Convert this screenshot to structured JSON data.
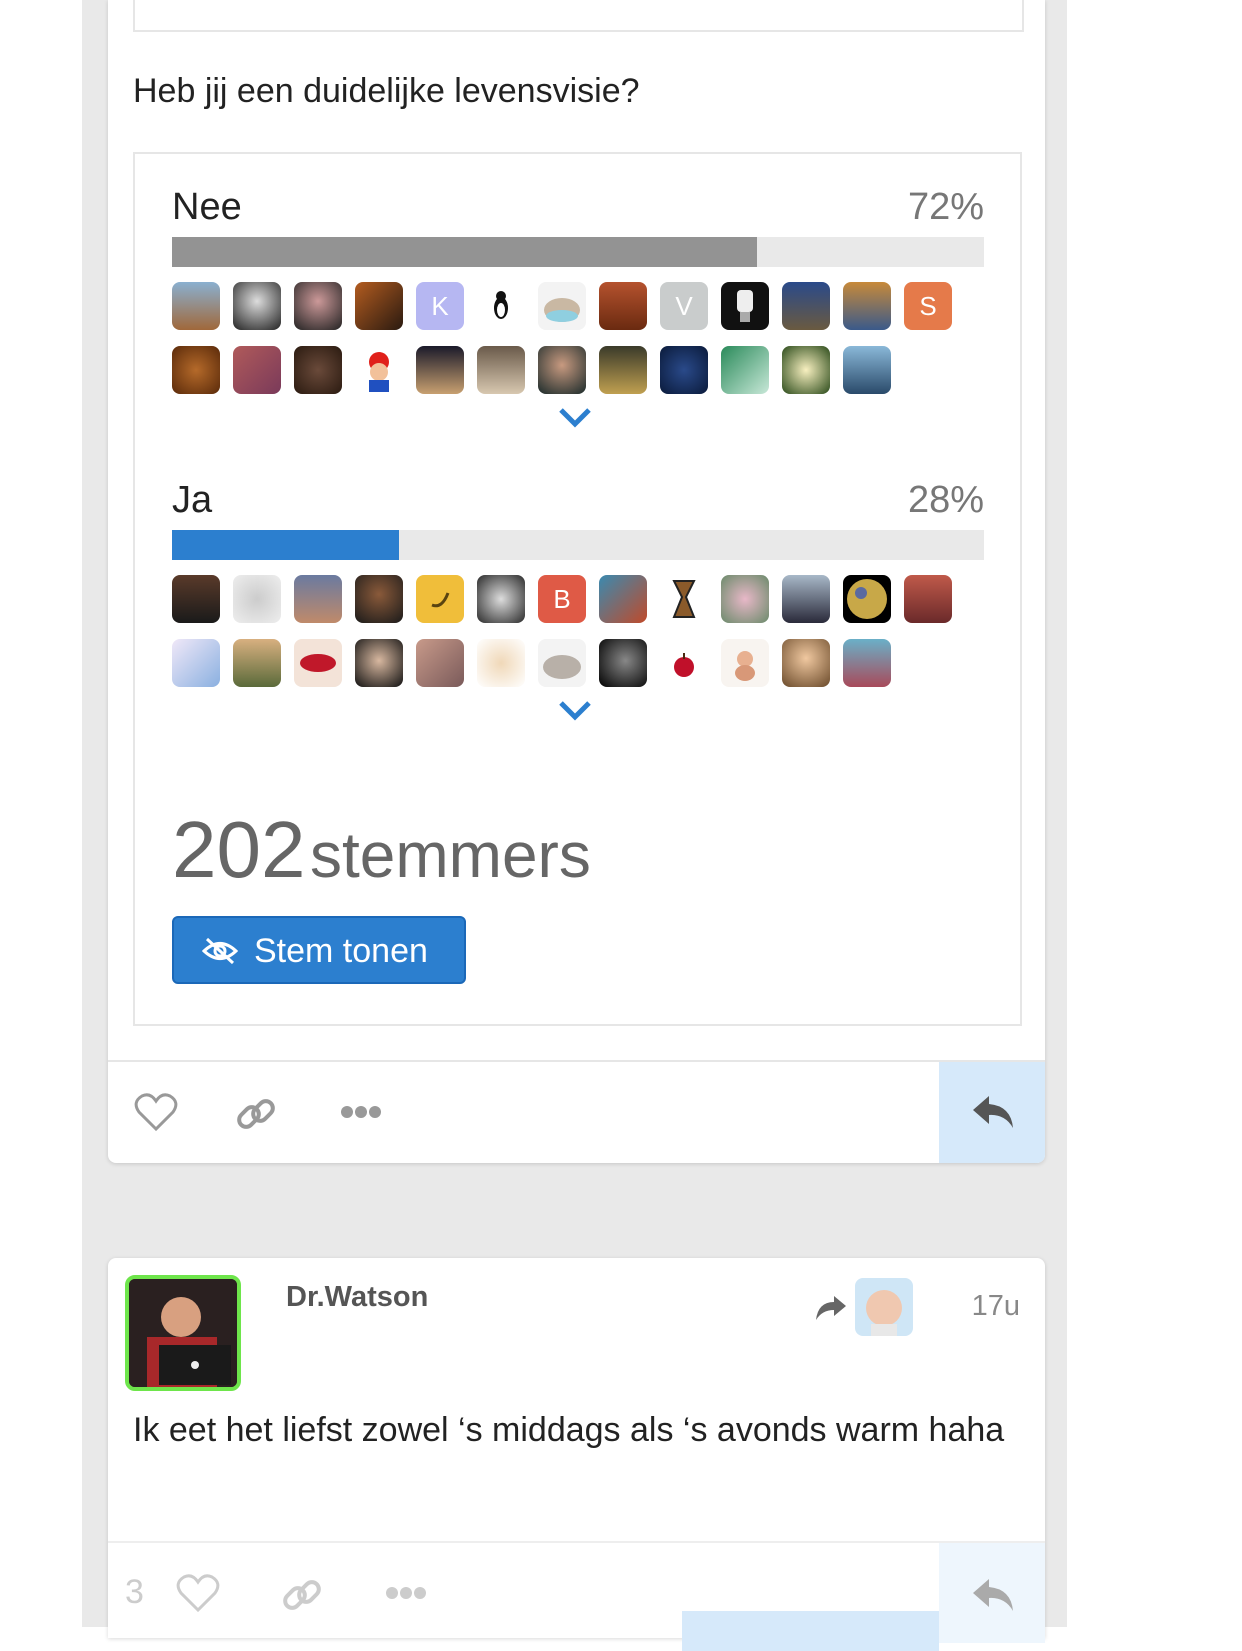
{
  "question": "Heb jij een duidelijke levensvisie?",
  "options": [
    {
      "label": "Nee",
      "percent": "72%",
      "fraction": 0.72,
      "color": "#939393"
    },
    {
      "label": "Ja",
      "percent": "28%",
      "fraction": 0.28,
      "color": "#2c7fcf"
    }
  ],
  "avatar_letters": {
    "k": "K",
    "v": "V",
    "s": "S",
    "b": "B"
  },
  "voters": {
    "count": "202",
    "label": "stemmers"
  },
  "vote_button": {
    "label": "Stem tonen"
  },
  "post": {
    "username": "Dr.Watson",
    "time": "17u",
    "text": "Ik eet het liefst zowel ‘s middags als ‘s avonds warm haha",
    "like_count": "3"
  },
  "colors": {
    "accent": "#2c7fcf",
    "online": "#6ee54b",
    "reply_bg": "#d6e9fa"
  }
}
